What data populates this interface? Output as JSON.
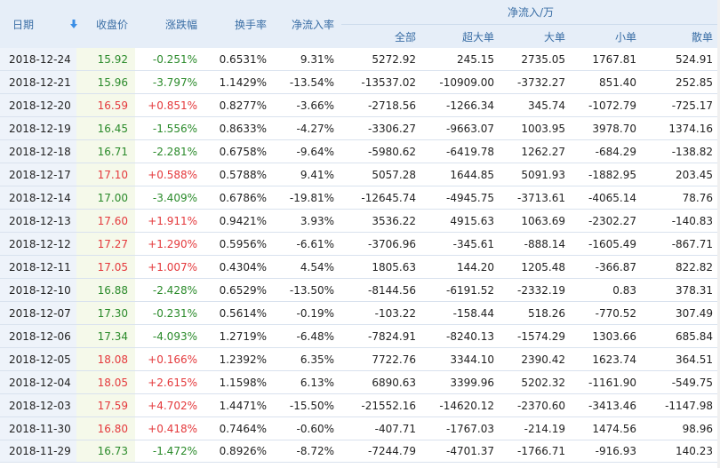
{
  "headers": {
    "date": "日期",
    "close": "收盘价",
    "change_pct": "涨跌幅",
    "turnover": "换手率",
    "inflow_rate": "净流入率",
    "net_inflow_group": "净流入/万",
    "all": "全部",
    "super_large": "超大单",
    "large": "大单",
    "small": "小单",
    "retail": "散单"
  },
  "sort_icon": "arrow-down-icon",
  "colors": {
    "up": "#e4393c",
    "down": "#2a8a2a",
    "header_text": "#3a6ea5",
    "header_bg": "#e6eef8"
  },
  "rows": [
    {
      "date": "2018-12-24",
      "close": "15.92",
      "change": "-0.251%",
      "dir": "down",
      "turnover": "0.6531%",
      "rate": "9.31%",
      "all": "5272.92",
      "super": "245.15",
      "large": "2735.05",
      "small": "1767.81",
      "retail": "524.91"
    },
    {
      "date": "2018-12-21",
      "close": "15.96",
      "change": "-3.797%",
      "dir": "down",
      "turnover": "1.1429%",
      "rate": "-13.54%",
      "all": "-13537.02",
      "super": "-10909.00",
      "large": "-3732.27",
      "small": "851.40",
      "retail": "252.85"
    },
    {
      "date": "2018-12-20",
      "close": "16.59",
      "change": "+0.851%",
      "dir": "up",
      "turnover": "0.8277%",
      "rate": "-3.66%",
      "all": "-2718.56",
      "super": "-1266.34",
      "large": "345.74",
      "small": "-1072.79",
      "retail": "-725.17"
    },
    {
      "date": "2018-12-19",
      "close": "16.45",
      "change": "-1.556%",
      "dir": "down",
      "turnover": "0.8633%",
      "rate": "-4.27%",
      "all": "-3306.27",
      "super": "-9663.07",
      "large": "1003.95",
      "small": "3978.70",
      "retail": "1374.16"
    },
    {
      "date": "2018-12-18",
      "close": "16.71",
      "change": "-2.281%",
      "dir": "down",
      "turnover": "0.6758%",
      "rate": "-9.64%",
      "all": "-5980.62",
      "super": "-6419.78",
      "large": "1262.27",
      "small": "-684.29",
      "retail": "-138.82"
    },
    {
      "date": "2018-12-17",
      "close": "17.10",
      "change": "+0.588%",
      "dir": "up",
      "turnover": "0.5788%",
      "rate": "9.41%",
      "all": "5057.28",
      "super": "1644.85",
      "large": "5091.93",
      "small": "-1882.95",
      "retail": "203.45"
    },
    {
      "date": "2018-12-14",
      "close": "17.00",
      "change": "-3.409%",
      "dir": "down",
      "turnover": "0.6786%",
      "rate": "-19.81%",
      "all": "-12645.74",
      "super": "-4945.75",
      "large": "-3713.61",
      "small": "-4065.14",
      "retail": "78.76"
    },
    {
      "date": "2018-12-13",
      "close": "17.60",
      "change": "+1.911%",
      "dir": "up",
      "turnover": "0.9421%",
      "rate": "3.93%",
      "all": "3536.22",
      "super": "4915.63",
      "large": "1063.69",
      "small": "-2302.27",
      "retail": "-140.83"
    },
    {
      "date": "2018-12-12",
      "close": "17.27",
      "change": "+1.290%",
      "dir": "up",
      "turnover": "0.5956%",
      "rate": "-6.61%",
      "all": "-3706.96",
      "super": "-345.61",
      "large": "-888.14",
      "small": "-1605.49",
      "retail": "-867.71"
    },
    {
      "date": "2018-12-11",
      "close": "17.05",
      "change": "+1.007%",
      "dir": "up",
      "turnover": "0.4304%",
      "rate": "4.54%",
      "all": "1805.63",
      "super": "144.20",
      "large": "1205.48",
      "small": "-366.87",
      "retail": "822.82"
    },
    {
      "date": "2018-12-10",
      "close": "16.88",
      "change": "-2.428%",
      "dir": "down",
      "turnover": "0.6529%",
      "rate": "-13.50%",
      "all": "-8144.56",
      "super": "-6191.52",
      "large": "-2332.19",
      "small": "0.83",
      "retail": "378.31"
    },
    {
      "date": "2018-12-07",
      "close": "17.30",
      "change": "-0.231%",
      "dir": "down",
      "turnover": "0.5614%",
      "rate": "-0.19%",
      "all": "-103.22",
      "super": "-158.44",
      "large": "518.26",
      "small": "-770.52",
      "retail": "307.49"
    },
    {
      "date": "2018-12-06",
      "close": "17.34",
      "change": "-4.093%",
      "dir": "down",
      "turnover": "1.2719%",
      "rate": "-6.48%",
      "all": "-7824.91",
      "super": "-8240.13",
      "large": "-1574.29",
      "small": "1303.66",
      "retail": "685.84"
    },
    {
      "date": "2018-12-05",
      "close": "18.08",
      "change": "+0.166%",
      "dir": "up",
      "turnover": "1.2392%",
      "rate": "6.35%",
      "all": "7722.76",
      "super": "3344.10",
      "large": "2390.42",
      "small": "1623.74",
      "retail": "364.51"
    },
    {
      "date": "2018-12-04",
      "close": "18.05",
      "change": "+2.615%",
      "dir": "up",
      "turnover": "1.1598%",
      "rate": "6.13%",
      "all": "6890.63",
      "super": "3399.96",
      "large": "5202.32",
      "small": "-1161.90",
      "retail": "-549.75"
    },
    {
      "date": "2018-12-03",
      "close": "17.59",
      "change": "+4.702%",
      "dir": "up",
      "turnover": "1.4471%",
      "rate": "-15.50%",
      "all": "-21552.16",
      "super": "-14620.12",
      "large": "-2370.60",
      "small": "-3413.46",
      "retail": "-1147.98"
    },
    {
      "date": "2018-11-30",
      "close": "16.80",
      "change": "+0.418%",
      "dir": "up",
      "turnover": "0.7464%",
      "rate": "-0.60%",
      "all": "-407.71",
      "super": "-1767.03",
      "large": "-214.19",
      "small": "1474.56",
      "retail": "98.96"
    },
    {
      "date": "2018-11-29",
      "close": "16.73",
      "change": "-1.472%",
      "dir": "down",
      "turnover": "0.8926%",
      "rate": "-8.72%",
      "all": "-7244.79",
      "super": "-4701.37",
      "large": "-1766.71",
      "small": "-916.93",
      "retail": "140.23"
    }
  ]
}
